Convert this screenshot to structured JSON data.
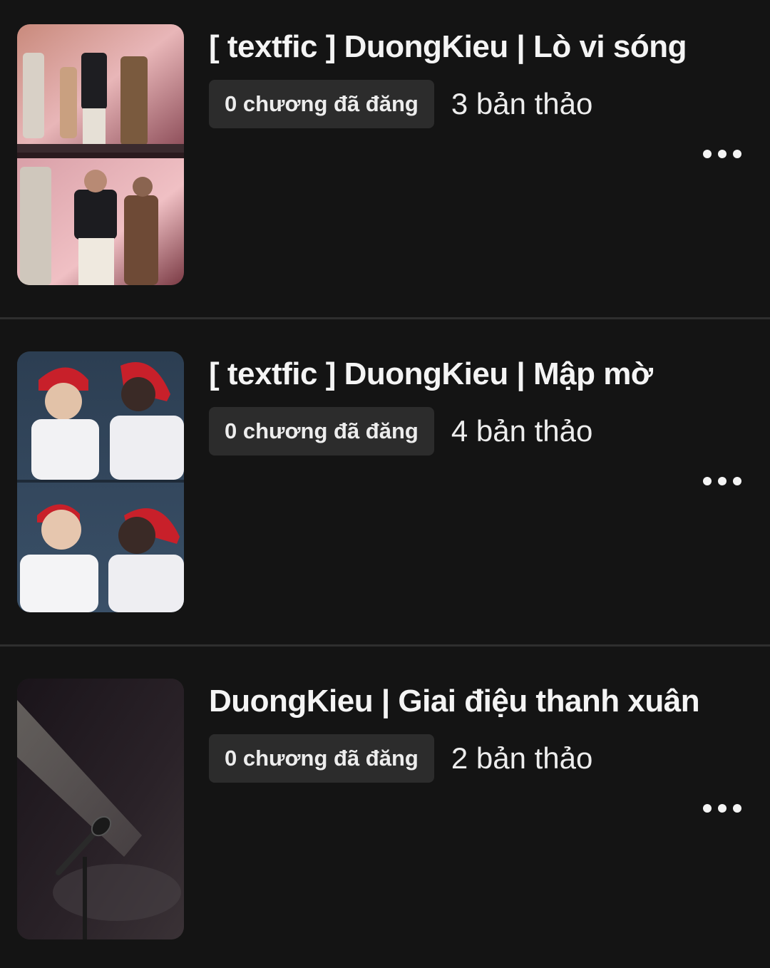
{
  "stories": [
    {
      "title": "[ textfic ] DuongKieu | Lò vi sóng",
      "published_label": "0 chương đã đăng",
      "drafts_label": "3 bản thảo",
      "cover_icon": "concert-stage-photo-collage"
    },
    {
      "title": "[ textfic ] DuongKieu | Mập mờ",
      "published_label": "0 chương đã đăng",
      "drafts_label": "4 bản thảo",
      "cover_icon": "santa-hat-duo-photo-collage"
    },
    {
      "title": "DuongKieu | Giai điệu thanh xuân",
      "published_label": "0 chương đã đăng",
      "drafts_label": "2 bản thảo",
      "cover_icon": "spotlight-microphone-photo"
    }
  ],
  "colors": {
    "background": "#141414",
    "badge_bg": "#2c2c2c",
    "text": "#f2f2f2",
    "divider": "#2e2e2e"
  }
}
